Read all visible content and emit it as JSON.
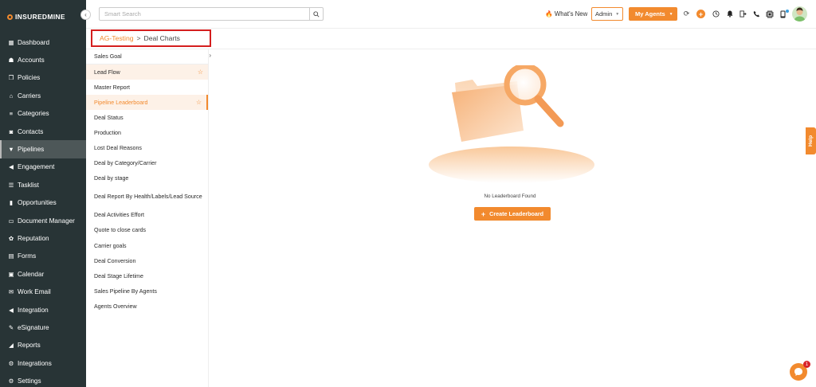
{
  "brand": {
    "name": "INSUREDMINE"
  },
  "sidebar": {
    "items": [
      {
        "label": "Dashboard",
        "icon": "dashboard-icon"
      },
      {
        "label": "Accounts",
        "icon": "accounts-icon"
      },
      {
        "label": "Policies",
        "icon": "policies-icon"
      },
      {
        "label": "Carriers",
        "icon": "carriers-icon"
      },
      {
        "label": "Categories",
        "icon": "categories-icon"
      },
      {
        "label": "Contacts",
        "icon": "contacts-icon"
      },
      {
        "label": "Pipelines",
        "icon": "pipelines-icon",
        "active": true
      },
      {
        "label": "Engagement",
        "icon": "megaphone-icon"
      },
      {
        "label": "Tasklist",
        "icon": "tasklist-icon"
      },
      {
        "label": "Opportunities",
        "icon": "opportunities-icon"
      },
      {
        "label": "Document Manager",
        "icon": "folder-icon"
      },
      {
        "label": "Reputation",
        "icon": "reputation-icon"
      },
      {
        "label": "Forms",
        "icon": "forms-icon"
      },
      {
        "label": "Calendar",
        "icon": "calendar-icon"
      },
      {
        "label": "Work Email",
        "icon": "email-icon"
      },
      {
        "label": "Integration",
        "icon": "megaphone-icon"
      },
      {
        "label": "eSignature",
        "icon": "signature-icon"
      },
      {
        "label": "Reports",
        "icon": "reports-icon"
      },
      {
        "label": "Integrations",
        "icon": "integrations-icon"
      },
      {
        "label": "Settings",
        "icon": "gear-icon"
      }
    ]
  },
  "topbar": {
    "search_placeholder": "Smart Search",
    "whats_new": "What's New",
    "admin_value": "Admin",
    "my_agents": "My Agents"
  },
  "breadcrumb": {
    "parent": "AG-Testing",
    "separator": ">",
    "current": "Deal Charts"
  },
  "reports": [
    {
      "label": "Sales Goal"
    },
    {
      "label": "Lead Flow",
      "starred": true,
      "highlight": true
    },
    {
      "label": "Master Report"
    },
    {
      "label": "Pipeline Leaderboard",
      "starred": true,
      "selected": true
    },
    {
      "label": "Deal Status"
    },
    {
      "label": "Production"
    },
    {
      "label": "Lost Deal Reasons"
    },
    {
      "label": "Deal by Category/Carrier"
    },
    {
      "label": "Deal by stage"
    },
    {
      "label": "Deal Report By Health/Labels/Lead Source",
      "tall": true
    },
    {
      "label": "Deal Activities Effort"
    },
    {
      "label": "Quote to close cards"
    },
    {
      "label": "Carrier goals"
    },
    {
      "label": "Deal Conversion"
    },
    {
      "label": "Deal Stage Lifetime"
    },
    {
      "label": "Sales Pipeline By Agents"
    },
    {
      "label": "Agents Overview"
    }
  ],
  "empty_state": {
    "message": "No Leaderboard Found",
    "button": "Create Leaderboard"
  },
  "help": {
    "label": "Help"
  },
  "chat": {
    "badge": "1"
  },
  "colors": {
    "accent": "#f28a2e",
    "sidebar": "#283436",
    "alert": "#d41e1e"
  }
}
